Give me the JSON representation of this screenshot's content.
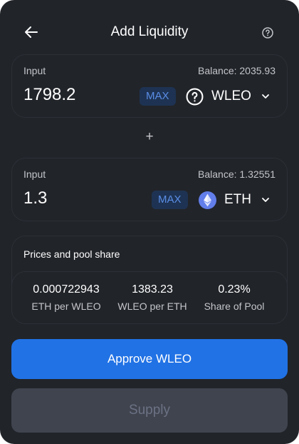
{
  "header": {
    "title": "Add Liquidity"
  },
  "inputs": [
    {
      "label": "Input",
      "balance": "Balance: 2035.93",
      "amount": "1798.2",
      "max_label": "MAX",
      "token": "WLEO",
      "token_icon": "question-circle-icon"
    },
    {
      "label": "Input",
      "balance": "Balance: 1.32551",
      "amount": "1.3",
      "max_label": "MAX",
      "token": "ETH",
      "token_icon": "eth-icon"
    }
  ],
  "plus_sign": "+",
  "prices": {
    "title": "Prices and pool share",
    "items": [
      {
        "value": "0.000722943",
        "label": "ETH per WLEO"
      },
      {
        "value": "1383.23",
        "label": "WLEO per ETH"
      },
      {
        "value": "0.23%",
        "label": "Share of Pool"
      }
    ]
  },
  "actions": {
    "approve": "Approve WLEO",
    "supply": "Supply"
  },
  "colors": {
    "background": "#212429",
    "accent": "#2172e5",
    "max_bg": "#1e3353",
    "max_text": "#5a8de6",
    "disabled_bg": "#40444f"
  }
}
